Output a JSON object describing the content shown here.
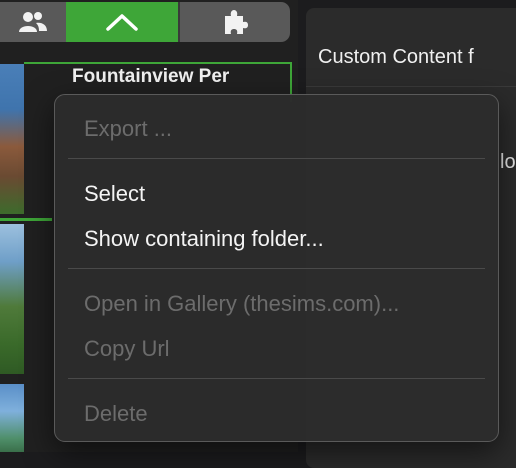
{
  "tabs": [
    {
      "icon": "people-icon",
      "active": false
    },
    {
      "icon": "chevron-up-icon",
      "active": true
    },
    {
      "icon": "puzzle-icon",
      "active": false
    }
  ],
  "lot_card": {
    "title": "Fountainview Per"
  },
  "right_panel": {
    "title": "Custom Content f",
    "fragment": "lo"
  },
  "context_menu": {
    "items": [
      {
        "label": "Export ...",
        "enabled": false
      },
      {
        "label": "Select",
        "enabled": true
      },
      {
        "label": "Show containing folder...",
        "enabled": true
      },
      {
        "label": "Open in Gallery (thesims.com)...",
        "enabled": false
      },
      {
        "label": "Copy Url",
        "enabled": false
      },
      {
        "label": "Delete",
        "enabled": false
      }
    ]
  },
  "colors": {
    "accent_green": "#3ea638",
    "menu_bg": "#2c2c2c",
    "disabled_text": "#6c6c6c"
  }
}
